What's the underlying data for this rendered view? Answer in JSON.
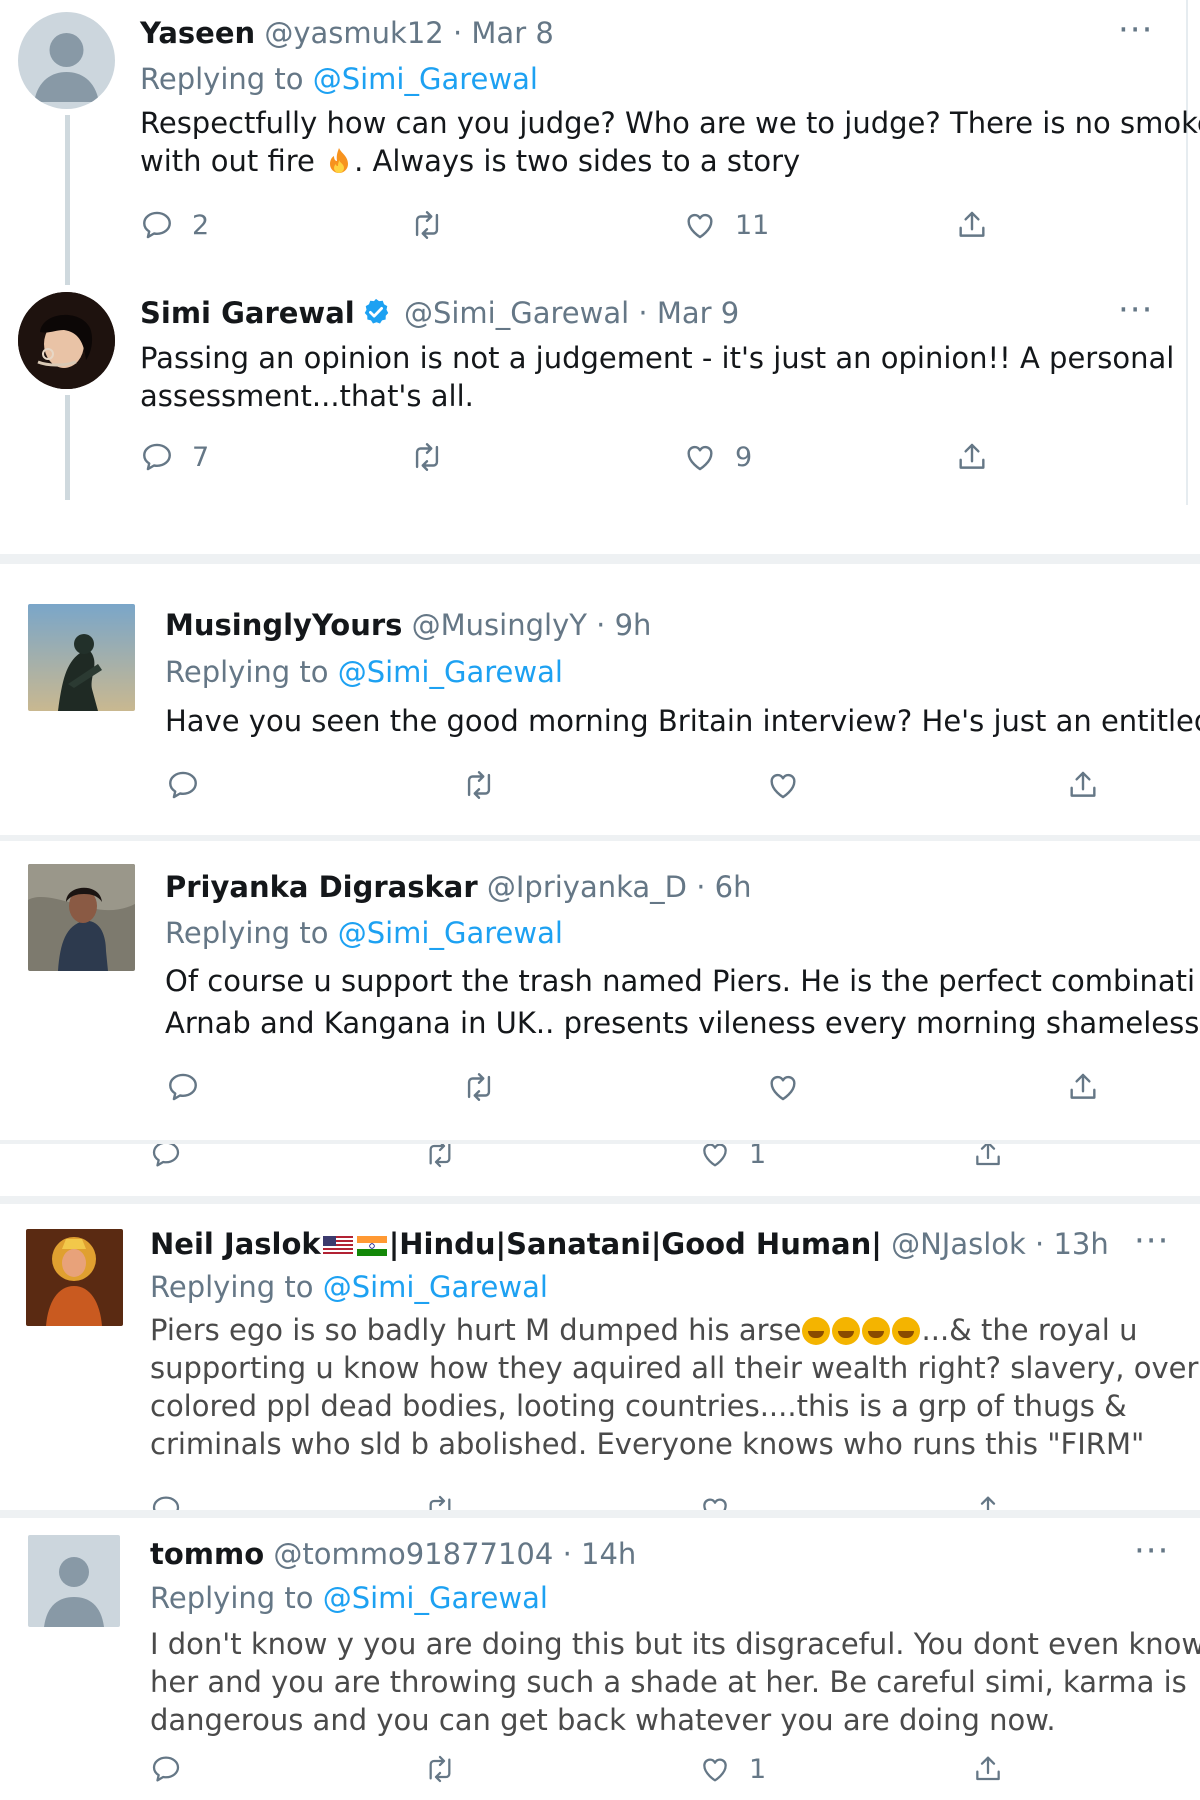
{
  "tweets": [
    {
      "name": "Yaseen",
      "handle": "@yasmuk12",
      "time": "Mar 8",
      "replying_prefix": "Replying to",
      "replying_to": "@Simi_Garewal",
      "body_lines": [
        "Respectfully how can you judge? Who are we to judge? There is no smoke",
        "with out fire",
        ". Always is two sides to a story"
      ],
      "reply_count": "2",
      "like_count": "11",
      "more": "···"
    },
    {
      "name": "Simi Garewal",
      "handle": "@Simi_Garewal",
      "time": "Mar 9",
      "body_lines": [
        "Passing an opinion is not a judgement - it's just an opinion!! A personal",
        "assessment...that's all."
      ],
      "reply_count": "7",
      "like_count": "9",
      "more": "···"
    },
    {
      "name": "MusinglyYours",
      "handle": "@MusinglyY",
      "time": "9h",
      "replying_prefix": "Replying to",
      "replying_to": "@Simi_Garewal",
      "body_lines": [
        "Have you seen the good morning Britain interview? He's just an entitled"
      ]
    },
    {
      "name": "Priyanka Digraskar",
      "handle": "@Ipriyanka_D",
      "time": "6h",
      "replying_prefix": "Replying to",
      "replying_to": "@Simi_Garewal",
      "body_lines": [
        "Of course u support the trash named Piers. He is the perfect combinati",
        "Arnab and Kangana in UK.. presents vileness every morning shamelessl"
      ]
    },
    {
      "partial_like_count": "1"
    },
    {
      "name_part1": "Neil Jaslok",
      "name_part2": "|Hindu|Sanatani|Good Human|",
      "handle": "@NJaslok",
      "time": "13h",
      "replying_prefix": "Replying to",
      "replying_to": "@Simi_Garewal",
      "body_line1_a": "Piers ego is so badly hurt M dumped his arse",
      "body_line1_b": "...& the royal u",
      "body_lines": [
        "supporting u know how they aquired all their wealth right? slavery, over",
        "colored ppl dead bodies, looting countries....this is a grp of thugs &",
        "criminals who sld b abolished. Everyone knows who runs this \"FIRM\""
      ],
      "more": "···"
    },
    {
      "name": "tommo",
      "handle": "@tommo91877104",
      "time": "14h",
      "replying_prefix": "Replying to",
      "replying_to": "@Simi_Garewal",
      "body_lines": [
        "I don't know y you are doing this but its disgraceful. You dont even know",
        "her  and you are throwing such a shade at her. Be careful simi, karma is",
        "dangerous and you can get back whatever you are doing now."
      ],
      "like_count": "1",
      "more": "···"
    }
  ],
  "colors": {
    "link": "#1da1f2",
    "meta": "#657786",
    "text": "#14171a",
    "thread": "#cfd9de"
  }
}
